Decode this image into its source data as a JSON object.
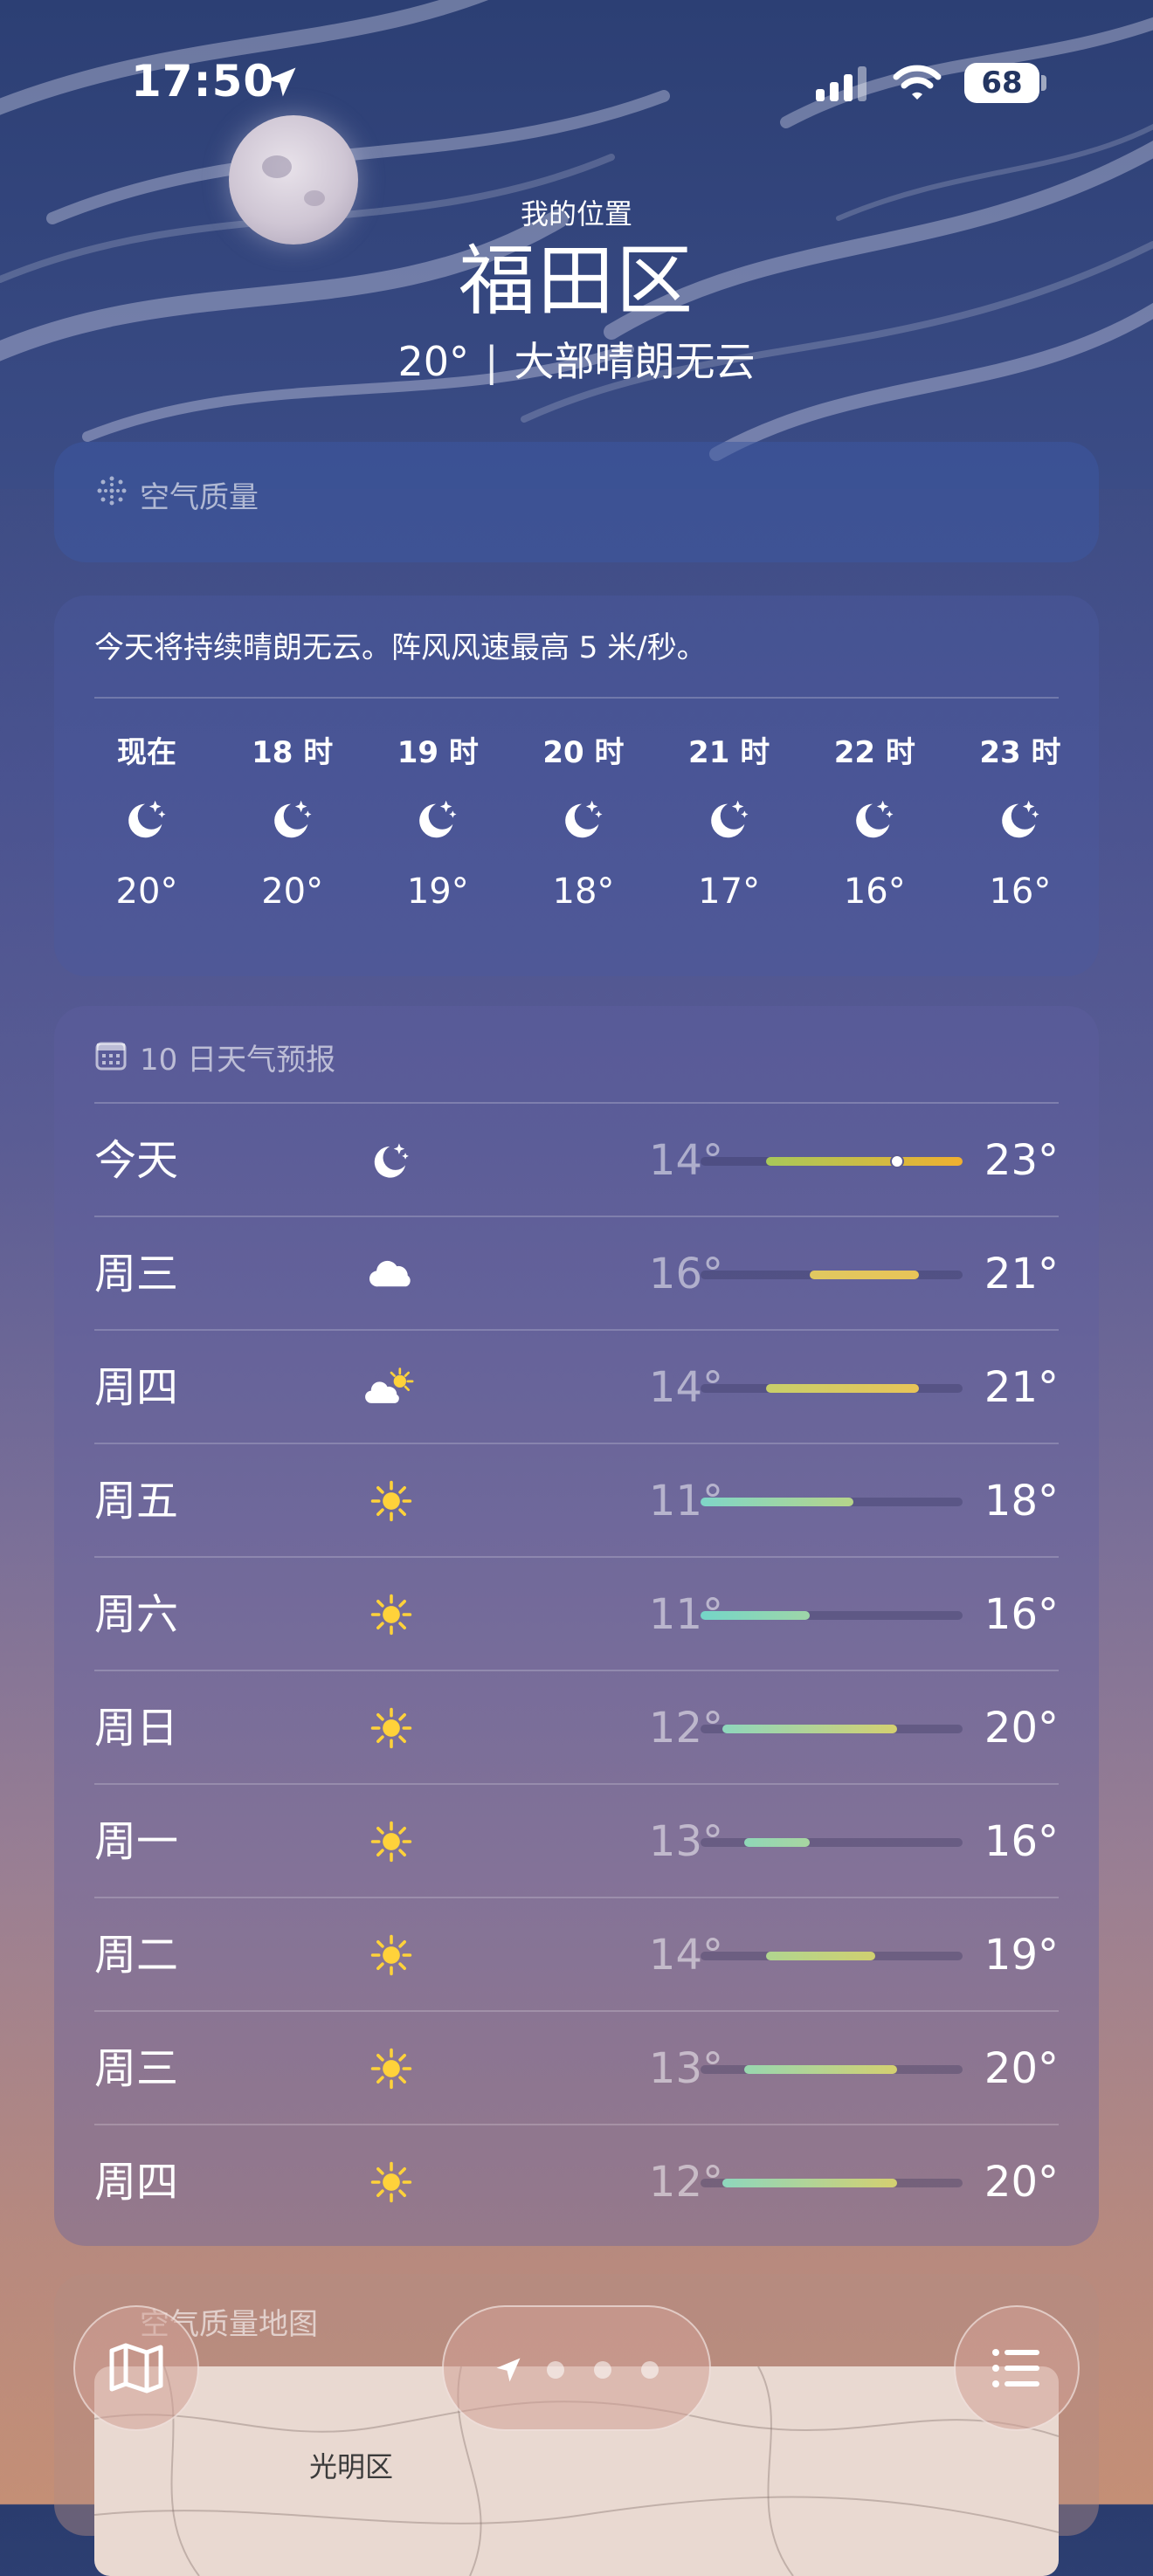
{
  "status_bar": {
    "time": "17:50",
    "battery": "68"
  },
  "header": {
    "my_location": "我的位置",
    "city": "福田区",
    "temp": "20°",
    "separator": "|",
    "condition": "大部晴朗无云"
  },
  "air_quality": {
    "label": "空气质量"
  },
  "hourly": {
    "summary": "今天将持续晴朗无云。阵风风速最高 5 米/秒。",
    "items": [
      {
        "hour": "现在",
        "icon": "moon-stars-icon",
        "temp": "20°"
      },
      {
        "hour": "18 时",
        "icon": "moon-stars-icon",
        "temp": "20°"
      },
      {
        "hour": "19 时",
        "icon": "moon-stars-icon",
        "temp": "19°"
      },
      {
        "hour": "20 时",
        "icon": "moon-stars-icon",
        "temp": "18°"
      },
      {
        "hour": "21 时",
        "icon": "moon-stars-icon",
        "temp": "17°"
      },
      {
        "hour": "22 时",
        "icon": "moon-stars-icon",
        "temp": "16°"
      },
      {
        "hour": "23 时",
        "icon": "moon-stars-icon",
        "temp": "16°"
      }
    ]
  },
  "daily": {
    "title": "10 日天气预报",
    "range_min": 11,
    "range_max": 23,
    "current_temp": 20,
    "items": [
      {
        "day": "今天",
        "icon": "moon-stars-icon",
        "low": "14°",
        "high": "23°",
        "low_v": 14,
        "high_v": 23,
        "gradient": [
          "#a8c85a",
          "#f0b030"
        ],
        "current": true
      },
      {
        "day": "周三",
        "icon": "cloud-icon",
        "low": "16°",
        "high": "21°",
        "low_v": 16,
        "high_v": 21,
        "gradient": [
          "#e0c860",
          "#e8c458"
        ]
      },
      {
        "day": "周四",
        "icon": "partly-sunny-icon",
        "low": "14°",
        "high": "21°",
        "low_v": 14,
        "high_v": 21,
        "gradient": [
          "#c8cf6a",
          "#e8c458"
        ]
      },
      {
        "day": "周五",
        "icon": "sun-icon",
        "low": "11°",
        "high": "18°",
        "low_v": 11,
        "high_v": 18,
        "gradient": [
          "#7fd6c8",
          "#b6d48a"
        ]
      },
      {
        "day": "周六",
        "icon": "sun-icon",
        "low": "11°",
        "high": "16°",
        "low_v": 11,
        "high_v": 16,
        "gradient": [
          "#74d5c8",
          "#9ed5a8"
        ]
      },
      {
        "day": "周日",
        "icon": "sun-icon",
        "low": "12°",
        "high": "20°",
        "low_v": 12,
        "high_v": 20,
        "gradient": [
          "#8ed7bd",
          "#d4d070"
        ]
      },
      {
        "day": "周一",
        "icon": "sun-icon",
        "low": "13°",
        "high": "16°",
        "low_v": 13,
        "high_v": 16,
        "gradient": [
          "#8fd7b8",
          "#a8d6a0"
        ]
      },
      {
        "day": "周二",
        "icon": "sun-icon",
        "low": "14°",
        "high": "19°",
        "low_v": 14,
        "high_v": 19,
        "gradient": [
          "#b0d590",
          "#d0d070"
        ]
      },
      {
        "day": "周三",
        "icon": "sun-icon",
        "low": "13°",
        "high": "20°",
        "low_v": 13,
        "high_v": 20,
        "gradient": [
          "#98d7b0",
          "#d4d070"
        ]
      },
      {
        "day": "周四",
        "icon": "sun-icon",
        "low": "12°",
        "high": "20°",
        "low_v": 12,
        "high_v": 20,
        "gradient": [
          "#8ed7bd",
          "#d4d070"
        ]
      }
    ]
  },
  "map_card": {
    "title": "空气质量地图",
    "place": "光明区"
  },
  "bottom_bar": {
    "map_icon": "map-icon",
    "list_icon": "list-icon",
    "location_icon": "location-arrow-icon"
  }
}
